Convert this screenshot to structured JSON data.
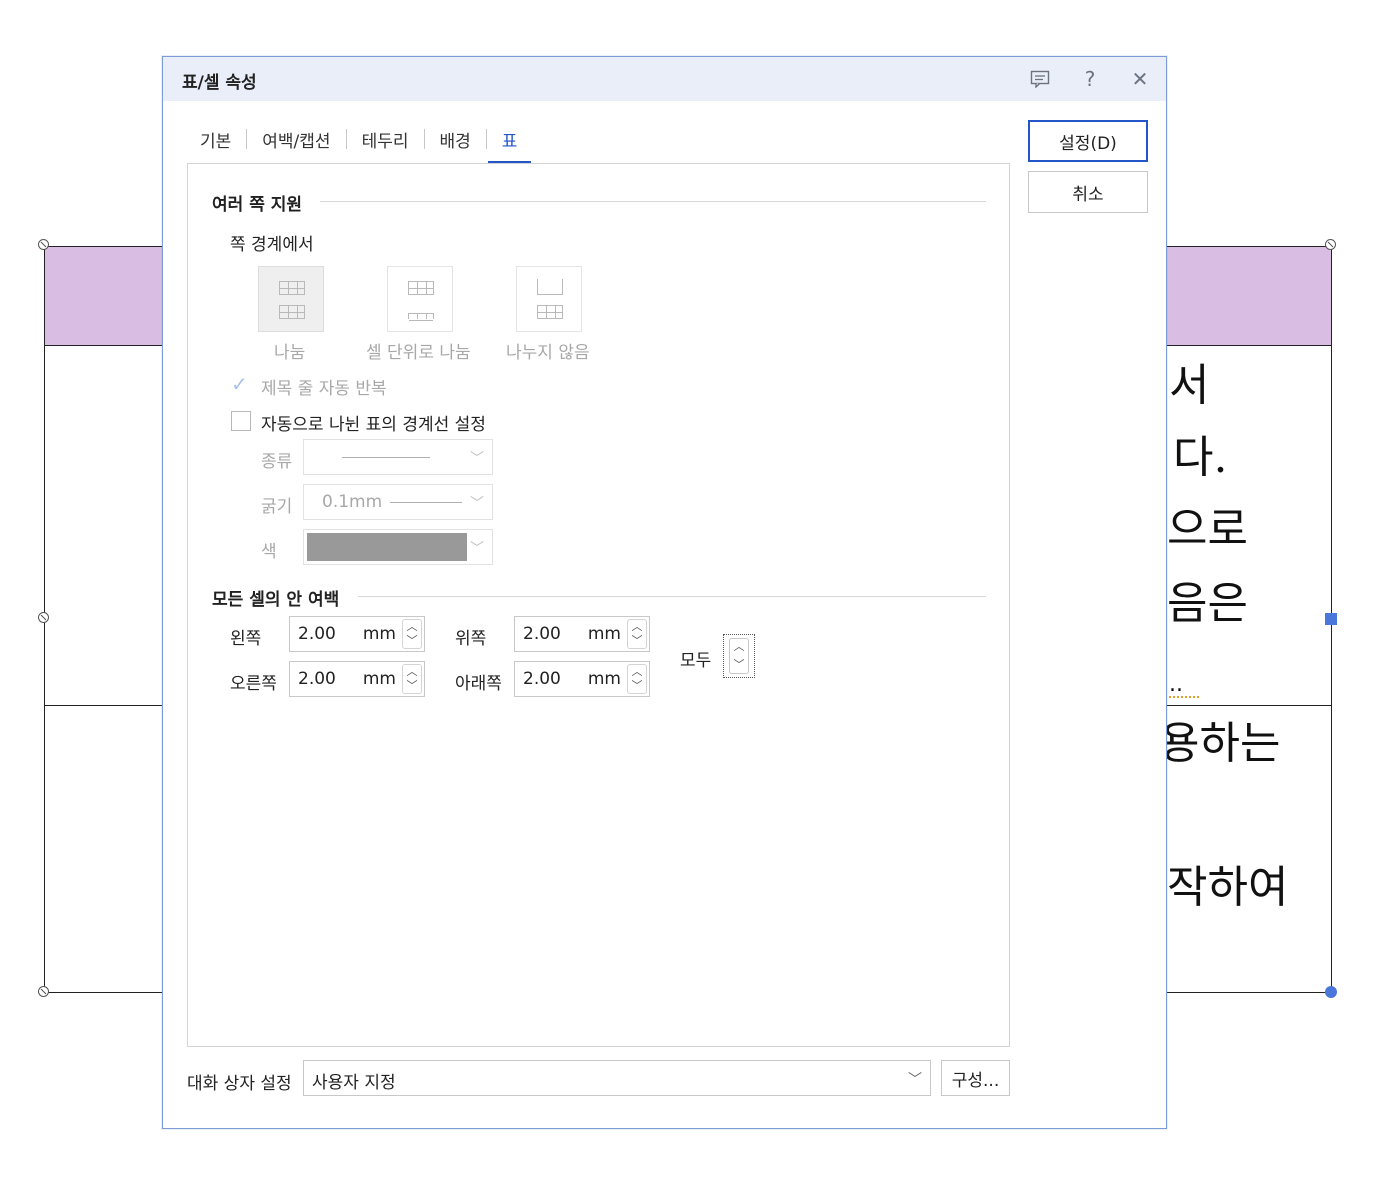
{
  "document": {
    "text_lines": [
      "서",
      "다.",
      "으로",
      "음은",
      "..",
      "용하는",
      "작하여"
    ]
  },
  "dialog": {
    "title": "표/셀 속성",
    "titlebar_buttons": [
      "comment-icon",
      "help-icon",
      "close-icon"
    ],
    "help_glyph": "?",
    "close_glyph": "✕",
    "tabs": [
      {
        "label": "기본",
        "active": false
      },
      {
        "label": "여백/캡션",
        "active": false
      },
      {
        "label": "테두리",
        "active": false
      },
      {
        "label": "배경",
        "active": false
      },
      {
        "label": "표",
        "active": true
      }
    ],
    "actions": {
      "ok_label": "설정(D)",
      "cancel_label": "취소"
    },
    "multi_page": {
      "title": "여러 쪽 지원",
      "boundary_label": "쪽 경계에서",
      "split_options": [
        {
          "label": "나눔",
          "selected": true
        },
        {
          "label": "셀 단위로 나눔",
          "selected": false
        },
        {
          "label": "나누지 않음",
          "selected": false
        }
      ],
      "repeat_header": {
        "label": "제목 줄 자동 반복",
        "checked": true,
        "disabled": true
      },
      "auto_border": {
        "label": "자동으로 나뉜 표의 경계선 설정",
        "checked": false
      },
      "type_label": "종류",
      "thickness_label": "굵기",
      "thickness_value": "0.1mm",
      "color_label": "색",
      "color_value": "#999999"
    },
    "cell_margin": {
      "title": "모든 셀의 안 여백",
      "left": {
        "label": "왼쪽",
        "value": "2.00",
        "unit": "mm"
      },
      "right": {
        "label": "오른쪽",
        "value": "2.00",
        "unit": "mm"
      },
      "top": {
        "label": "위쪽",
        "value": "2.00",
        "unit": "mm"
      },
      "bottom": {
        "label": "아래쪽",
        "value": "2.00",
        "unit": "mm"
      },
      "all_label": "모두"
    },
    "footer": {
      "label": "대화 상자 설정",
      "select_value": "사용자 지정",
      "config_label": "구성..."
    }
  },
  "colors": {
    "accent": "#2456c9",
    "header_fill": "#d9bde3",
    "titlebar": "#e9eef9"
  }
}
